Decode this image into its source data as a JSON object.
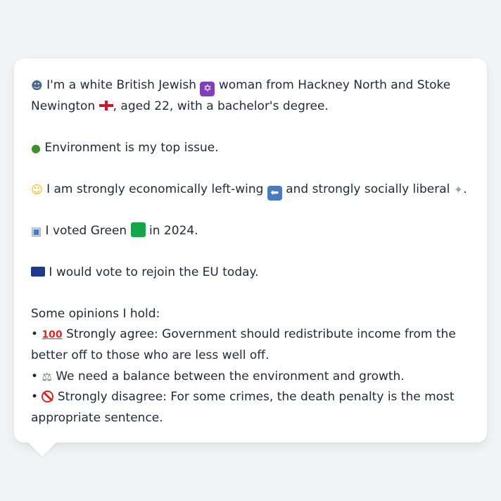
{
  "message": {
    "identity": {
      "icon": "person-silhouette-icon",
      "text1": "I'm a white British Jewish",
      "icon2": "star-of-david-icon",
      "text2": "woman from Hackney North and Stoke",
      "text3": "Newington",
      "icon3": "england-flag-icon",
      "text4": ", aged 22, with a bachelor's degree."
    },
    "top_issue": {
      "icon": "tree-icon",
      "text": "Environment is my top issue."
    },
    "ideology": {
      "icon": "thinking-face-icon",
      "text1": "I am strongly economically left-wing",
      "icon2": "left-arrow-icon",
      "text2": "and strongly socially liberal",
      "icon3": "dove-icon",
      "text3": "."
    },
    "vote": {
      "icon": "ballot-box-icon",
      "text1": "I voted Green",
      "icon2": "green-square-icon",
      "text2": "in 2024."
    },
    "eu": {
      "icon": "eu-flag-icon",
      "text": "I would vote to rejoin the EU today."
    },
    "opinions_heading": "Some opinions I hold:",
    "opinions": [
      {
        "bullet": "•",
        "icon": "hundred-points-icon",
        "text": "Strongly agree: Government should redistribute income from the better off to those who are less well off."
      },
      {
        "bullet": "•",
        "icon": "balance-scale-icon",
        "text": "We need a balance between the environment and growth."
      },
      {
        "bullet": "•",
        "icon": "no-entry-icon",
        "text": "Strongly disagree: For some crimes, the death penalty is the most appropriate sentence."
      }
    ]
  },
  "colors": {
    "background": "#f3f4f6",
    "bubble": "#ffffff",
    "text": "#1f2937",
    "green_square": "#16a34a",
    "purple_star": "#7e3fb8",
    "blue_arrow": "#4b7bbf",
    "eu_blue": "#1e3a8a",
    "red": "#dc2626"
  }
}
